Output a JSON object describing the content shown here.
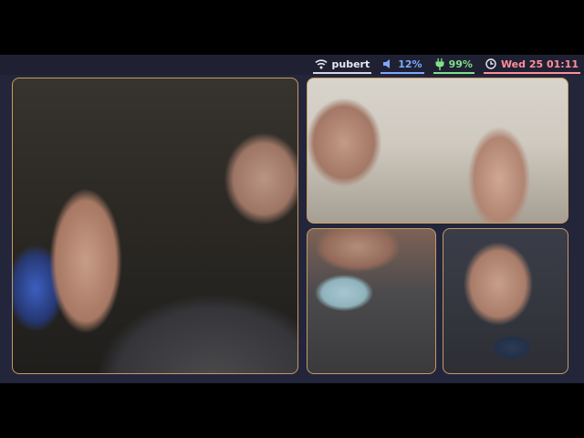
{
  "statusbar": {
    "wifi": {
      "icon": "wifi-icon",
      "label": "pubert"
    },
    "volume": {
      "icon": "speaker-icon",
      "label": "12%"
    },
    "battery": {
      "icon": "plug-icon",
      "label": "99%"
    },
    "clock": {
      "icon": "clock-icon",
      "label": "Wed 25 01:11"
    }
  },
  "colors": {
    "bar_background": "#1f2133",
    "desktop_background": "#23253a",
    "window_border": "#c49a66",
    "wifi_accent": "#d6d6e6",
    "volume_accent": "#7ea8ff",
    "battery_accent": "#7fe08a",
    "clock_accent": "#ff8f9a"
  },
  "windows": [
    {
      "role": "video-tile"
    },
    {
      "role": "video-tile"
    },
    {
      "role": "video-tile"
    },
    {
      "role": "video-tile"
    }
  ]
}
